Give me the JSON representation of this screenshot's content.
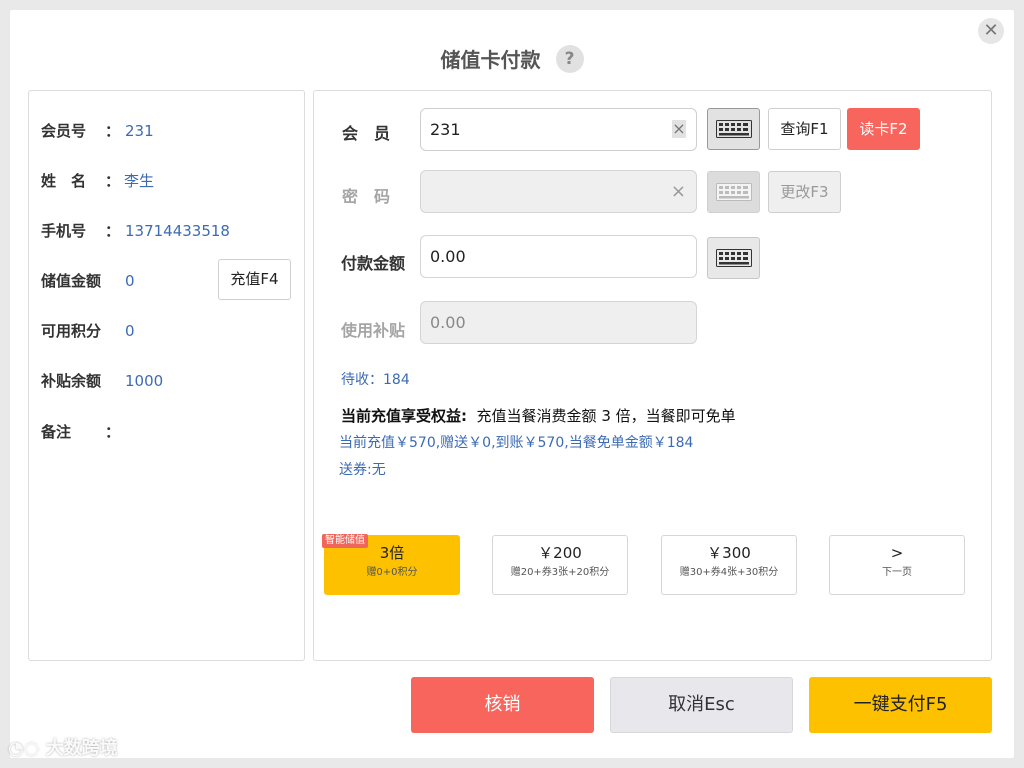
{
  "dialog": {
    "title": "储值卡付款",
    "help_icon": "question-icon",
    "close_icon": "close-icon"
  },
  "member_info": {
    "rows": [
      {
        "label": "会员号",
        "colon": "：",
        "value": "231"
      },
      {
        "label": "姓　名",
        "colon": "：",
        "value": "李生"
      },
      {
        "label": "手机号",
        "colon": "：",
        "value": "13714433518"
      },
      {
        "label": "储值金额",
        "colon": "",
        "value": "0"
      },
      {
        "label": "可用积分",
        "colon": "",
        "value": "0"
      },
      {
        "label": "补贴余额",
        "colon": "",
        "value": "1000"
      },
      {
        "label": "备注",
        "colon": "：",
        "value": ""
      }
    ],
    "recharge_button": "充值F4"
  },
  "form": {
    "member": {
      "label": "会　员",
      "value": "231",
      "clear": "×"
    },
    "password": {
      "label": "密　码",
      "value": "",
      "clear": "×"
    },
    "amount": {
      "label": "付款金额",
      "value": "0.00"
    },
    "subsidy": {
      "label": "使用补贴",
      "value": "0.00"
    },
    "query_button": "查询F1",
    "read_card_button": "读卡F2",
    "change_button": "更改F3",
    "keyboard_icon": "keyboard-icon"
  },
  "summary": {
    "pending": "待收：184",
    "benefit_label": "当前充值享受权益:",
    "benefit_text": "充值当餐消费金额 3 倍，当餐即可免单",
    "detail": "当前充值￥570,赠送￥0,到账￥570,当餐免单金额￥184",
    "coupon": "送券:无"
  },
  "options": [
    {
      "main": "3倍",
      "sub": "赠0+0积分",
      "badge": "智能储值",
      "selected": true
    },
    {
      "main": "￥200",
      "sub": "赠20+券3张+20积分",
      "badge": "",
      "selected": false
    },
    {
      "main": "￥300",
      "sub": "赠30+券4张+30积分",
      "badge": "",
      "selected": false
    },
    {
      "main": ">",
      "sub": "下一页",
      "badge": "",
      "selected": false
    }
  ],
  "footer": {
    "cancel_order": "核销",
    "cancel": "取消Esc",
    "pay": "一键支付F5"
  },
  "watermark": "大数跨境",
  "colors": {
    "primary_yellow": "#fdc100",
    "danger_red": "#f8655d",
    "link_blue": "#3d6bb3"
  }
}
